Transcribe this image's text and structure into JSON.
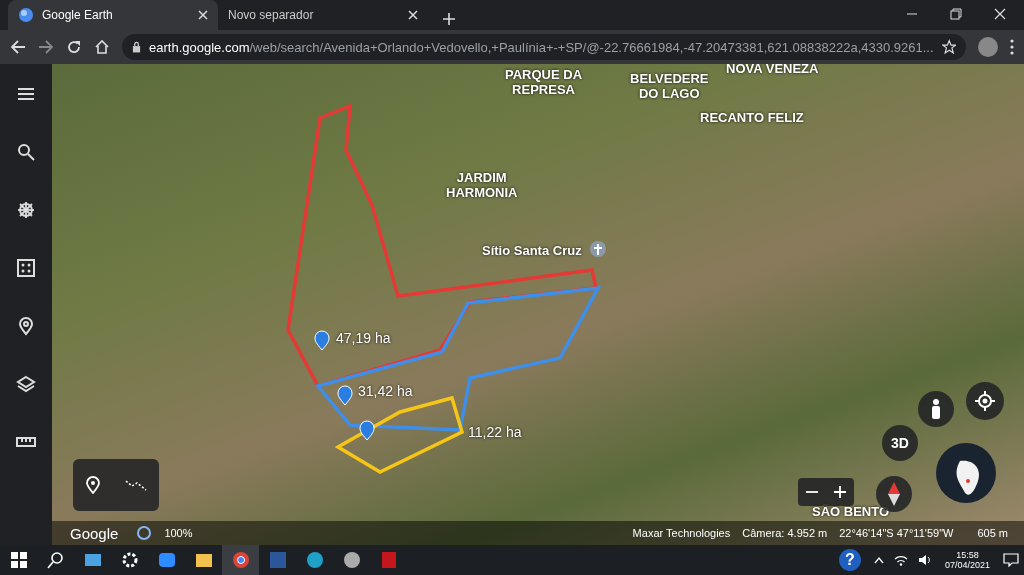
{
  "browser": {
    "tabs": [
      {
        "title": "Google Earth",
        "selected": true
      },
      {
        "title": "Novo separador",
        "selected": false
      }
    ],
    "url_host": "earth.google.com",
    "url_path": "/web/search/Avenida+Orlando+Vedovello,+Paulínia+-+SP/@-22.76661984,-47.20473381,621.08838222a,4330.9261..."
  },
  "map": {
    "place_labels": [
      "PARQUE DA\nREPRESA",
      "BELVEDERE\nDO LAGO",
      "NOVA VENEZA",
      "RECANTO FELIZ",
      "JARDIM\nHARMONIA",
      "Sítio Santa Cruz",
      "SÃO BENTO"
    ],
    "areas": [
      {
        "label": "47,19 ha",
        "color": "#e53935"
      },
      {
        "label": "31,42 ha",
        "color": "#3f8ee8"
      },
      {
        "label": "11,22 ha",
        "color": "#f5c518"
      }
    ],
    "view_button": "3D"
  },
  "status_bar": {
    "logo": "Google",
    "progress": "100%",
    "credit": "Maxar Technologies",
    "camera": "Câmera: 4.952 m",
    "coords": "22°46'14\"S 47°11'59\"W",
    "elevation": "605 m"
  },
  "taskbar": {
    "help": "?",
    "time": "15:58",
    "date": "07/04/2021"
  }
}
